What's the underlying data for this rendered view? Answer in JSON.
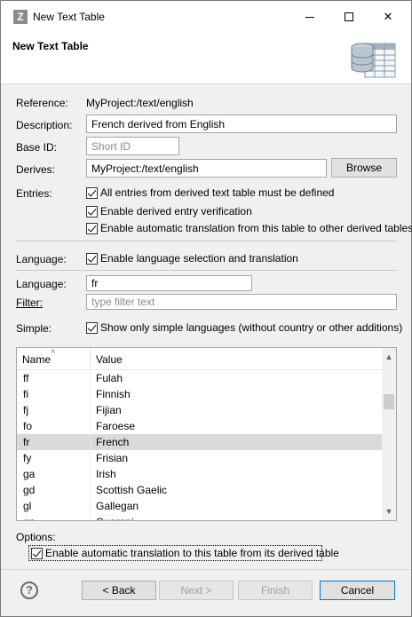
{
  "window": {
    "title": "New Text Table",
    "app_icon_letter": "Z"
  },
  "banner": {
    "title": "New Text Table",
    "icon": "database-table-icon"
  },
  "form": {
    "reference_label": "Reference:",
    "reference_value": "MyProject:/text/english",
    "description_label": "Description:",
    "description_value": "French derived from English",
    "base_id_label": "Base ID:",
    "base_id_placeholder": "Short ID",
    "derives_label": "Derives:",
    "derives_value": "MyProject:/text/english",
    "browse_label": "Browse",
    "entries_label": "Entries:",
    "entries_options": [
      "All entries from derived text table must be defined",
      "Enable derived entry verification",
      "Enable automatic translation from this table to other derived tables"
    ],
    "language_label": "Language:",
    "language_selection_option": "Enable language selection and translation",
    "language_field_label": "Language:",
    "language_value": "fr",
    "filter_label": "Filter:",
    "filter_placeholder": "type filter text",
    "simple_label": "Simple:",
    "simple_option": "Show only simple languages (without country or other additions)"
  },
  "table": {
    "columns": [
      "Name",
      "Value"
    ],
    "rows": [
      {
        "name": "ff",
        "value": "Fulah"
      },
      {
        "name": "fi",
        "value": "Finnish"
      },
      {
        "name": "fj",
        "value": "Fijian"
      },
      {
        "name": "fo",
        "value": "Faroese"
      },
      {
        "name": "fr",
        "value": "French"
      },
      {
        "name": "fy",
        "value": "Frisian"
      },
      {
        "name": "ga",
        "value": "Irish"
      },
      {
        "name": "gd",
        "value": "Scottish Gaelic"
      },
      {
        "name": "gl",
        "value": "Gallegan"
      },
      {
        "name": "gn",
        "value": "Guarani"
      }
    ],
    "selected_index": 4
  },
  "options": {
    "label": "Options:",
    "auto_translation_option": "Enable automatic translation to this table from its derived table"
  },
  "buttons": {
    "back": "< Back",
    "next": "Next >",
    "finish": "Finish",
    "cancel": "Cancel"
  }
}
